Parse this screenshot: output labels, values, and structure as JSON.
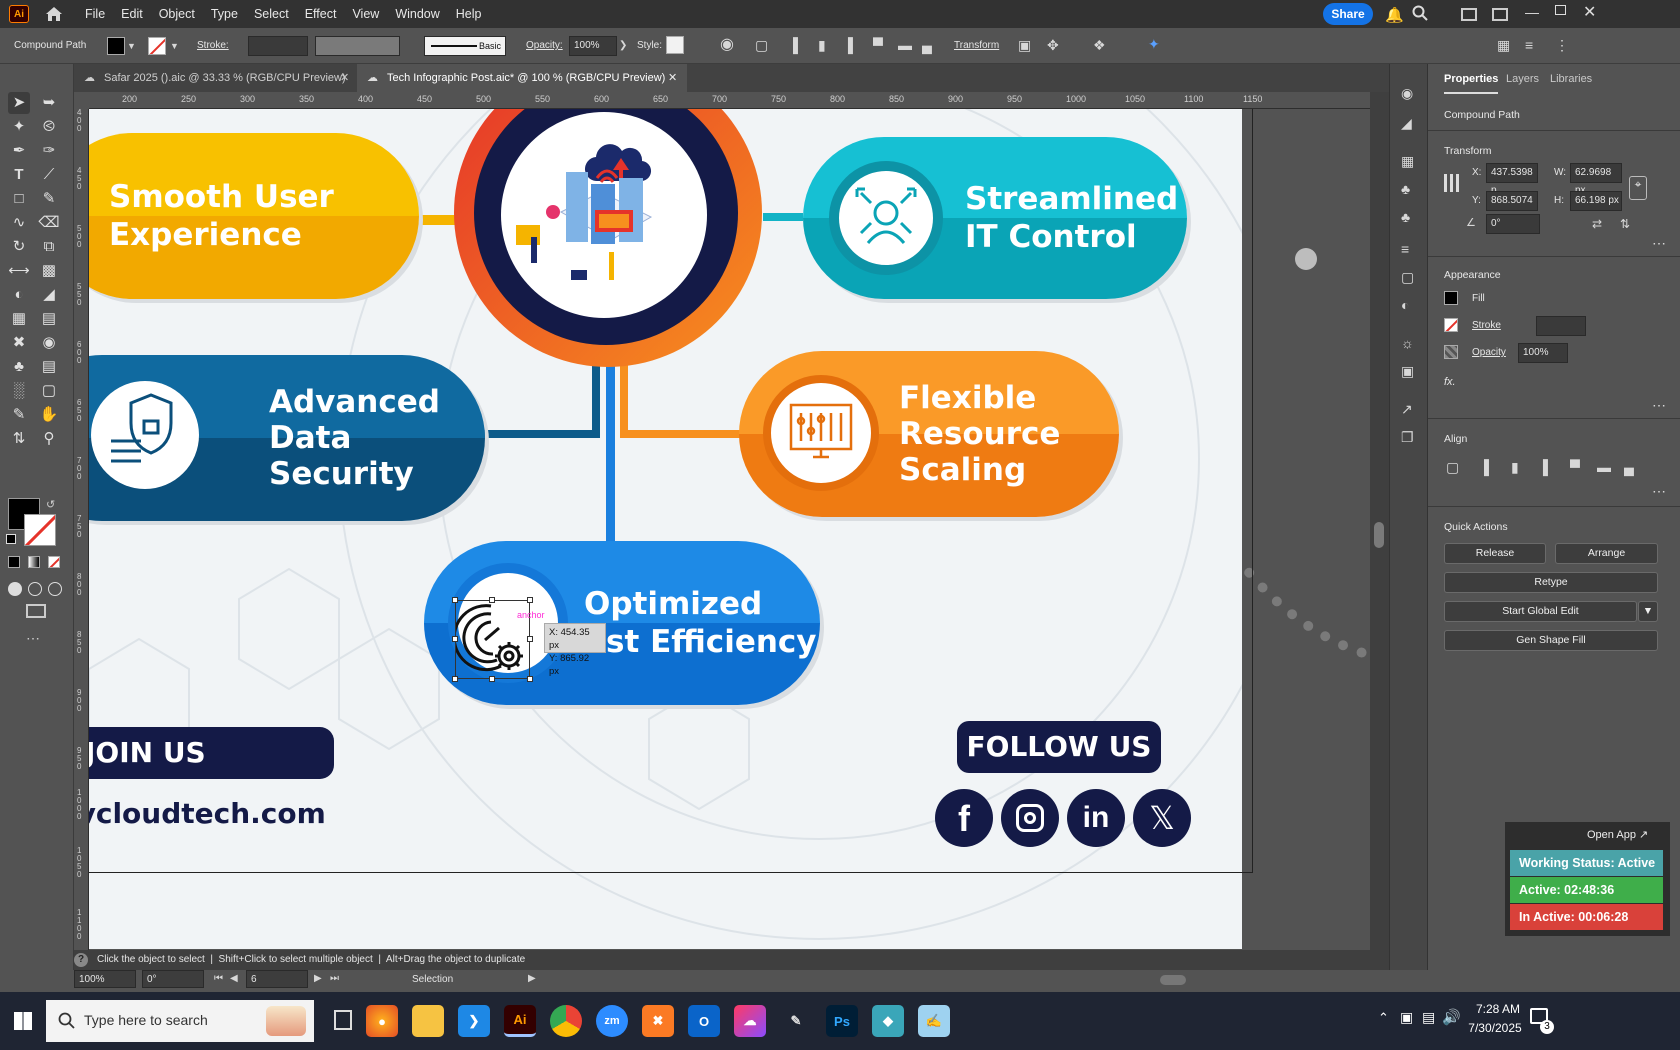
{
  "menubar": {
    "app_icon": "Ai",
    "items": [
      "File",
      "Edit",
      "Object",
      "Type",
      "Select",
      "Effect",
      "View",
      "Window",
      "Help"
    ],
    "share_label": "Share"
  },
  "control_bar": {
    "object_type": "Compound Path",
    "stroke_label": "Stroke:",
    "brush_label": "Basic",
    "opacity_label": "Opacity:",
    "opacity_value": "100%",
    "style_label": "Style:",
    "transform_label": "Transform"
  },
  "tabs": [
    {
      "label": "Safar 2025 ().aic @ 33.33 % (RGB/CPU Preview)"
    },
    {
      "label": "Tech Infographic Post.aic* @ 100 % (RGB/CPU Preview)"
    }
  ],
  "ruler": {
    "h_ticks": [
      "200",
      "250",
      "300",
      "350",
      "400",
      "450",
      "500",
      "550",
      "600",
      "650",
      "700",
      "750",
      "800",
      "850",
      "900",
      "950",
      "1000",
      "1050",
      "1100",
      "1150"
    ],
    "v_ticks": [
      "4 0 0",
      "4 5 0",
      "5 0 0",
      "5 5 0",
      "6 0 0",
      "6 5 0",
      "7 0 0",
      "7 5 0",
      "8 0 0",
      "8 5 0",
      "9 0 0",
      "9 5 0",
      "1 0 0 0",
      "1 0 5 0",
      "1 1 0 0"
    ]
  },
  "artboard": {
    "pills": {
      "smooth": "Smooth User\nExperience",
      "streamlined": "Streamlined\nIT Control",
      "advanced": "Advanced\nData\nSecurity",
      "flexible": "Flexible\nResource\nScaling",
      "optimized_line1": "Optimized",
      "optimized_line2": "st Efficiency"
    },
    "join_us": "JOIN US",
    "website": "v.vcloudtech.com",
    "follow_us": "FOLLOW US",
    "social_icons": [
      "facebook-icon",
      "instagram-icon",
      "linkedin-icon",
      "x-icon"
    ],
    "anchor_label": "anchor",
    "tooltip_x": "X: 454.35 px",
    "tooltip_y": "Y: 865.92 px",
    "colors": {
      "yellow": "#f5b400",
      "teal": "#12b3c6",
      "navy": "#0d5b8a",
      "orange": "#f7901e",
      "blue": "#1a7fde",
      "dark_navy": "#141a47",
      "red": "#e5332a"
    }
  },
  "properties_panel": {
    "tabs": [
      "Properties",
      "Layers",
      "Libraries"
    ],
    "object_type": "Compound Path",
    "transform_title": "Transform",
    "x_label": "X:",
    "x_value": "437.5398 p",
    "y_label": "Y:",
    "y_value": "868.5074 p",
    "w_label": "W:",
    "w_value": "62.9698 px",
    "h_label": "H:",
    "h_value": "66.198 px",
    "angle_value": "0°",
    "appearance_title": "Appearance",
    "fill_label": "Fill",
    "stroke_label": "Stroke",
    "opacity_label": "Opacity",
    "opacity_value": "100%",
    "fx_label": "fx.",
    "align_title": "Align",
    "quick_actions_title": "Quick Actions",
    "buttons": {
      "release": "Release",
      "arrange": "Arrange",
      "retype": "Retype",
      "global_edit": "Start Global Edit",
      "gen_shape_fill": "Gen Shape Fill"
    }
  },
  "status": {
    "hint": "Click the object to select  |  Shift+Click to select multiple object  |  Alt+Drag the object to duplicate",
    "zoom": "100%",
    "rotation": "0°",
    "artboard_num": "6",
    "mode": "Selection"
  },
  "widget": {
    "open_app": "Open App ↗",
    "working_status": "Working Status: Active",
    "active_time": "Active: 02:48:36",
    "inactive_time": "In Active: 00:06:28",
    "colors": {
      "working": "#4aa3a8",
      "active": "#3fae4a",
      "inactive": "#d9413a"
    }
  },
  "taskbar": {
    "search_placeholder": "Type here to search",
    "time": "7:28 AM",
    "date": "7/30/2025",
    "notification_count": "3",
    "apps": [
      "firefox-icon",
      "file-explorer-icon",
      "vscode-icon",
      "illustrator-icon",
      "chrome-icon",
      "zoom-icon",
      "xampp-icon",
      "outlook-icon",
      "creative-cloud-icon",
      "pen-tool-icon",
      "photoshop-icon",
      "git-icon",
      "notepad-icon"
    ]
  }
}
